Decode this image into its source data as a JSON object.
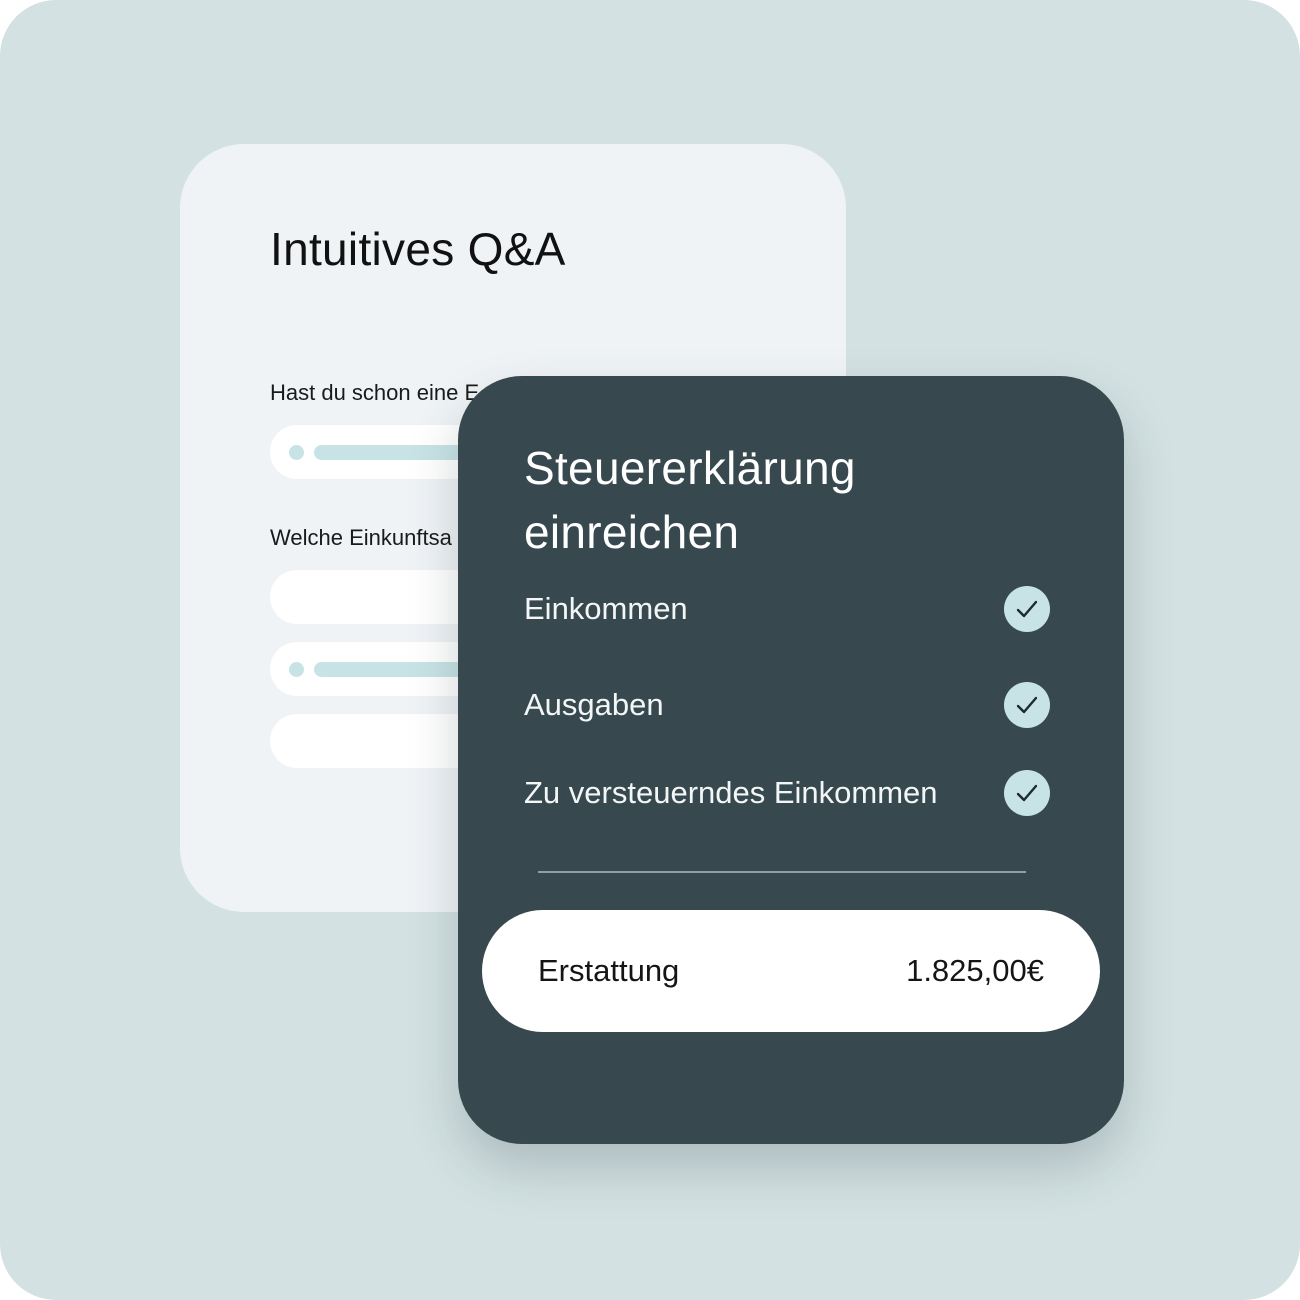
{
  "qa_card": {
    "title": "Intuitives Q&A",
    "questions": [
      {
        "text": "Hast du schon eine E"
      },
      {
        "text": "Welche Einkunftsa"
      }
    ]
  },
  "tax_card": {
    "title_line1": "Steuererklärung",
    "title_line2": "einreichen",
    "items": [
      {
        "label": "Einkommen",
        "icon": "check-icon",
        "checked": true
      },
      {
        "label": "Ausgaben",
        "icon": "check-icon",
        "checked": true
      },
      {
        "label": "Zu versteuerndes Einkommen",
        "icon": "check-icon",
        "checked": true
      }
    ],
    "refund": {
      "label": "Erstattung",
      "amount": "1.825,00€"
    }
  },
  "colors": {
    "background": "#d3e1e2",
    "qa_card": "#eff3f6",
    "tax_card": "#37494f",
    "accent": "#c8e3e6"
  }
}
